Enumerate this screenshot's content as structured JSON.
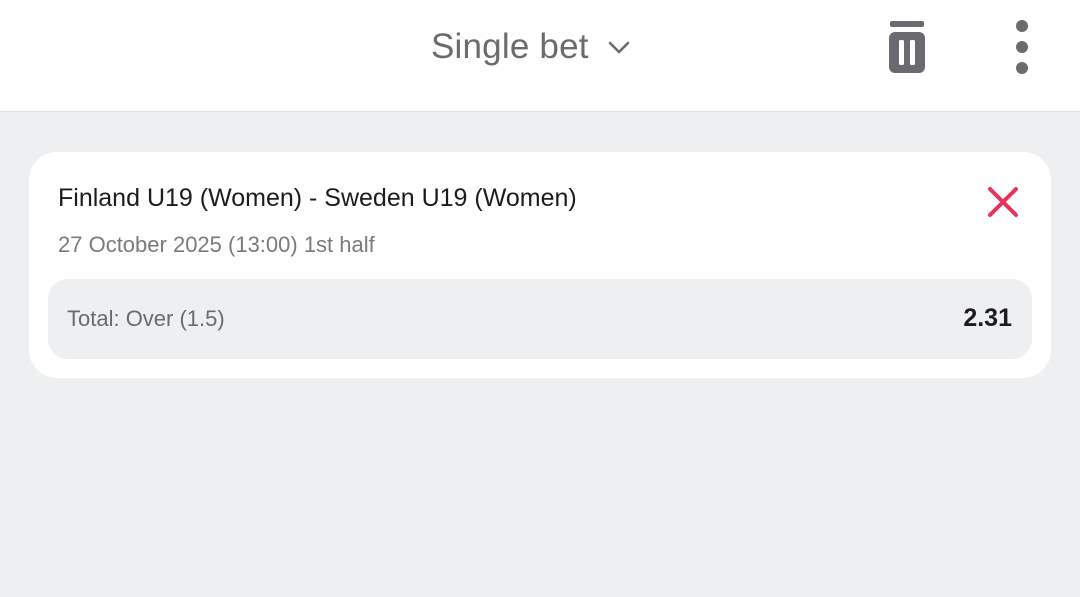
{
  "header": {
    "title": "Single bet",
    "icons": {
      "dropdown": "chevron-down-icon",
      "delete": "trash-icon",
      "menu": "more-vertical-icon"
    }
  },
  "bet": {
    "match": "Finland U19 (Women) - Sweden U19 (Women)",
    "datetime": "27 October 2025 (13:00) 1st half",
    "outcome": "Total: Over (1.5)",
    "odds": "2.31",
    "remove_icon": "close-icon"
  },
  "colors": {
    "background": "#eeeff1",
    "card": "#ffffff",
    "accent_remove": "#e8315b",
    "text_primary": "#1c1c1e",
    "text_secondary": "#7a7a7f"
  }
}
